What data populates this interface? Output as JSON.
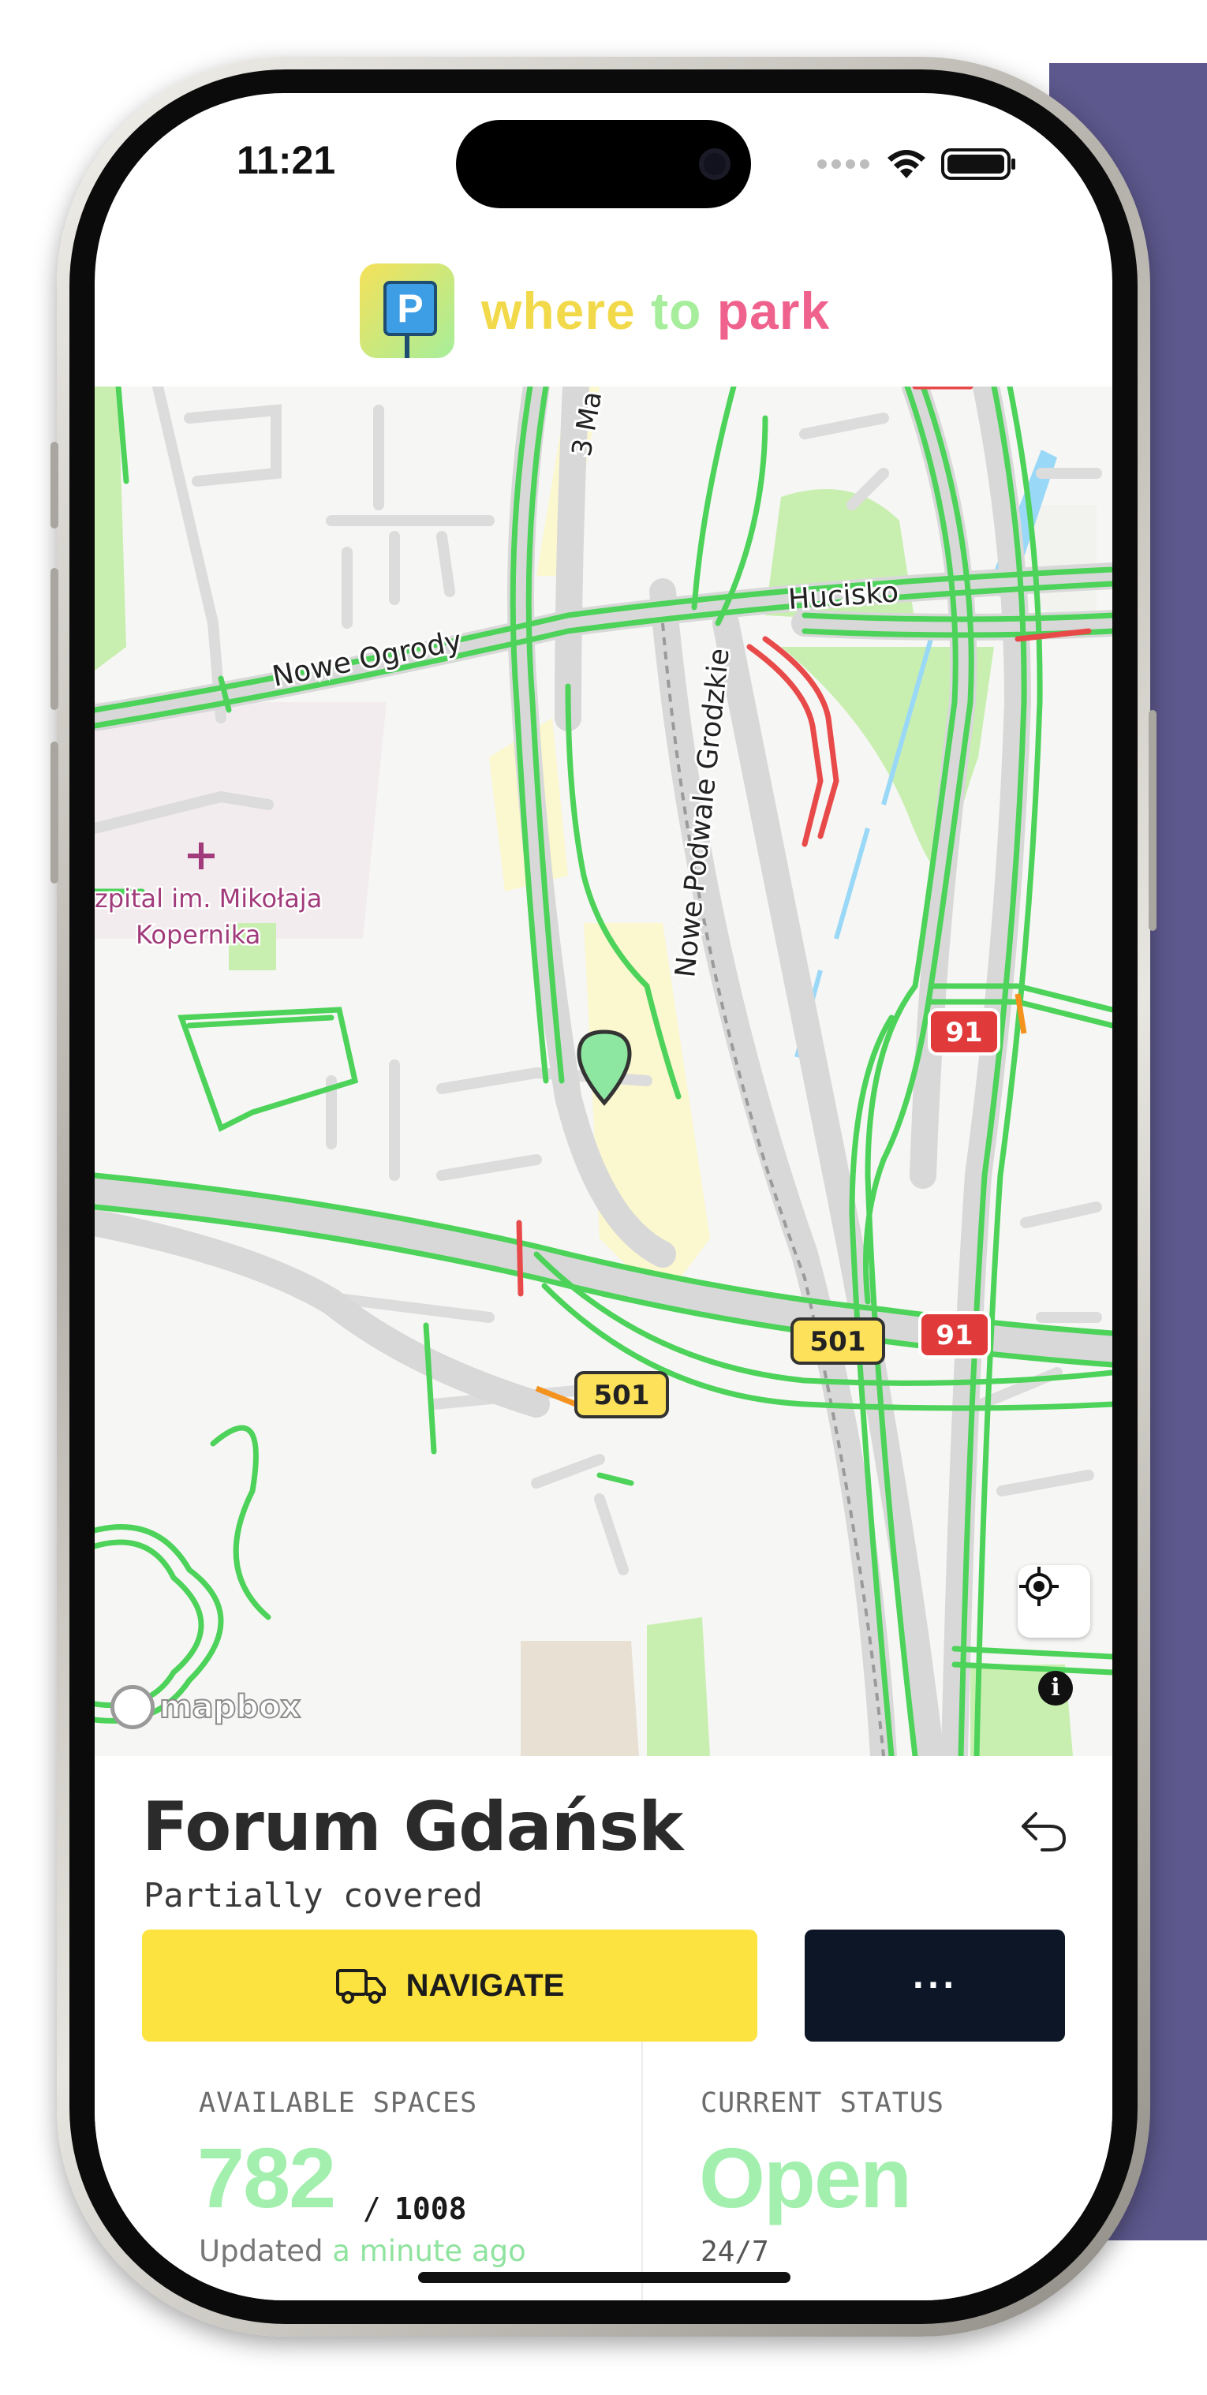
{
  "status_bar": {
    "time": "11:21"
  },
  "app": {
    "logo_sign": "P",
    "name_words": [
      "where",
      "to",
      "park"
    ]
  },
  "map": {
    "street_labels": [
      "3 Ma",
      "Nowe Ogrody",
      "Hucisko",
      "Nowe Podwale Grodzkie"
    ],
    "poi_label_line1": "zpital im. Mikołaja",
    "poi_label_line2": "Kopernika",
    "road_shields": [
      "91",
      "91",
      "501",
      "501"
    ],
    "attribution": "mapbox",
    "info_symbol": "i"
  },
  "place": {
    "title": "Forum Gdańsk",
    "subtitle": "Partially covered"
  },
  "actions": {
    "navigate_label": "NAVIGATE",
    "more_label": "···"
  },
  "stats": {
    "available_label": "AVAILABLE SPACES",
    "available_value": "782",
    "separator": "/",
    "total_value": "1008",
    "updated_prefix": "Updated",
    "updated_when": "a minute ago",
    "status_label": "CURRENT STATUS",
    "status_value": "Open",
    "hours": "24/7"
  },
  "colors": {
    "accent_yellow": "#fce33f",
    "accent_green": "#a2efae",
    "traffic_green": "#4dd25a",
    "traffic_red": "#e84a4a",
    "dark_button": "#0c1626"
  },
  "icons": [
    "wifi-icon",
    "battery-icon",
    "signal-dots-icon",
    "locate-icon",
    "info-icon",
    "undo-arrow-icon",
    "truck-icon",
    "pin-marker-icon"
  ]
}
